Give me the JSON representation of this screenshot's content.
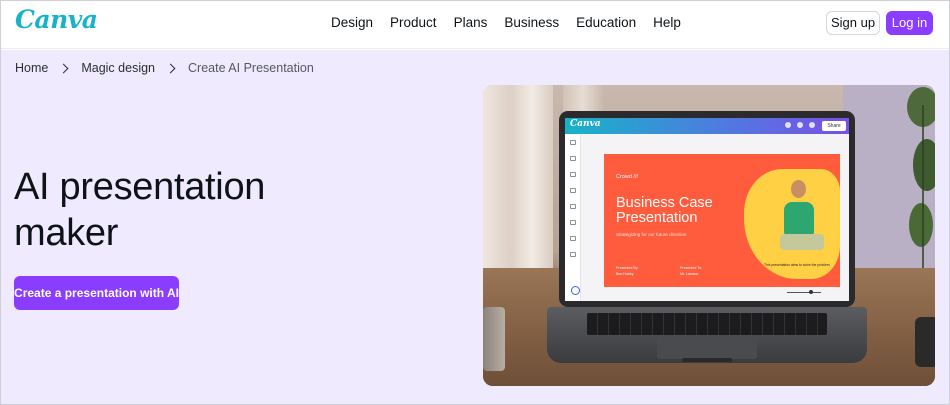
{
  "header": {
    "logo_text_1": "Ca",
    "logo_text_2": "nva",
    "nav": [
      "Design",
      "Product",
      "Plans",
      "Business",
      "Education",
      "Help"
    ],
    "signup_label": "Sign up",
    "login_label": "Log in"
  },
  "breadcrumb": {
    "items": [
      "Home",
      "Magic design",
      "Create AI Presentation"
    ]
  },
  "hero": {
    "headline_line1": "AI presentation",
    "headline_line2": "maker",
    "cta_label": "Create a presentation with AI"
  },
  "laptop_app": {
    "logo": "Canva",
    "share_label": "Share"
  },
  "slide": {
    "brand": "Crowd ///",
    "title": "Business Case Presentation",
    "subtitle": "Strategizing for our future direction",
    "presented_by_label": "Presented By:",
    "presented_by_value": "Ben Hatley",
    "presented_to_label": "Presented To:",
    "presented_to_value": "Mr. Lawson",
    "note": "This presentation aims to solve the problem"
  },
  "colors": {
    "brand_purple": "#8b3dff",
    "hero_bg": "#efeafd",
    "logo_teal": "#19b3c9",
    "slide_orange": "#ff5b3d"
  }
}
